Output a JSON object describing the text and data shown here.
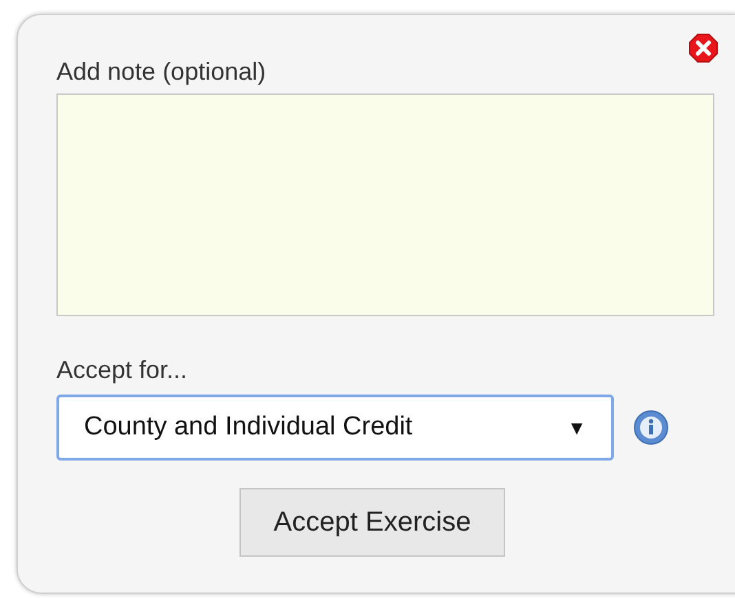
{
  "dialog": {
    "note_label": "Add note (optional)",
    "accept_label": "Accept for...",
    "accept_select": {
      "value": "County and Individual Credit",
      "arrow": "▼",
      "focused": true
    },
    "button": "Accept Exercise"
  }
}
